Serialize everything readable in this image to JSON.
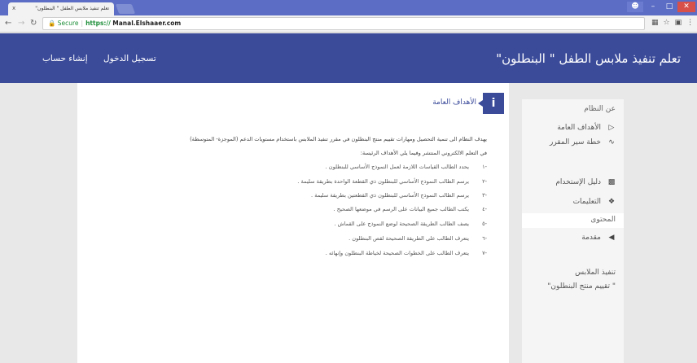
{
  "browser": {
    "tab_title": "تعلم تنفيذ ملابس الطفل \" البنطلون\"",
    "tab_close": "x",
    "url_secure_label": "Secure",
    "url_protocol": "https://",
    "url_domain": "Manal.Elshaaer.com"
  },
  "header": {
    "site_title": "تعلم تنفيذ ملابس الطفل \" البنطلون\"",
    "login_label": "تسجيل الدخول",
    "register_label": "إنشاء حساب"
  },
  "sidebar": {
    "about_label": "عن النظام",
    "items": [
      {
        "label": "الأهداف العامة",
        "icon": "tag-icon"
      },
      {
        "label": "خطة سير المقرر",
        "icon": "chart-line-icon"
      },
      {
        "label": "دليل الإستخدام",
        "icon": "document-icon"
      },
      {
        "label": "التعليمات",
        "icon": "info-icon"
      }
    ],
    "content_label": "المحتوى",
    "intro_label": "مقدمة",
    "course_line1": "تنفيذ الملابس",
    "course_line2": "\" تقييم منتج البنطلون\""
  },
  "main": {
    "heading_icon": "i",
    "heading": "الأهداف العامة",
    "intro_line1": "يهدف النظام الى تنمية التحصيل ومهارات تقييم منتج البنطلون في مقرر تنفيذ الملابس باستخدام مستويات الدعم (الموجزة- المتوسطة)",
    "intro_line2": "في التعلم الالكتروني المنتشر وفيما يلي الأهداف الرئيسة:",
    "objectives": [
      {
        "num": "-١",
        "text": "يحدد الطالب القياسات اللازمة لعمل النموذج الأساسي للبنطلون ."
      },
      {
        "num": "-٢",
        "text": "يرسم الطالب النموذج الأساسي للبنطلون ذي القطعة الواحدة بطريقة سليمة ."
      },
      {
        "num": "-٣",
        "text": "يرسم الطالب النموذج الأساسي للبنطلون ذي القطعتين بطريقة سليمة ."
      },
      {
        "num": "-٤",
        "text": "يكتب الطالب جميع البيانات على الرسم في موضعها الصحيح ."
      },
      {
        "num": "-٥",
        "text": "يصف الطالب الطريقة الصحيحة لوضع النموذج على القماش ."
      },
      {
        "num": "-٦",
        "text": "يتعرف الطالب على الطريقة الصحيحة لقص البنطلون ."
      },
      {
        "num": "-٧",
        "text": "يتعرف الطالب على الخطوات الصحيحة لخياطة البنطلون وإنهائه ."
      }
    ]
  }
}
